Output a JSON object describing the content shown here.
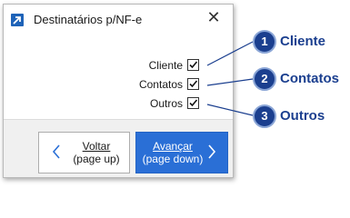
{
  "dialog": {
    "title": "Destinatários p/NF-e",
    "close_glyph": "✕",
    "options": [
      {
        "label": "Cliente",
        "checked": true
      },
      {
        "label": "Contatos",
        "checked": true
      },
      {
        "label": "Outros",
        "checked": true
      }
    ],
    "back_button": {
      "line1": "Voltar",
      "line2": "(page up)"
    },
    "next_button": {
      "line1": "Avançar",
      "line2": "(page down)"
    }
  },
  "callouts": [
    {
      "number": "1",
      "label": "Cliente"
    },
    {
      "number": "2",
      "label": "Contatos"
    },
    {
      "number": "3",
      "label": "Outros"
    }
  ],
  "colors": {
    "accent": "#2a6fd6",
    "callout": "#1b3f8f"
  }
}
